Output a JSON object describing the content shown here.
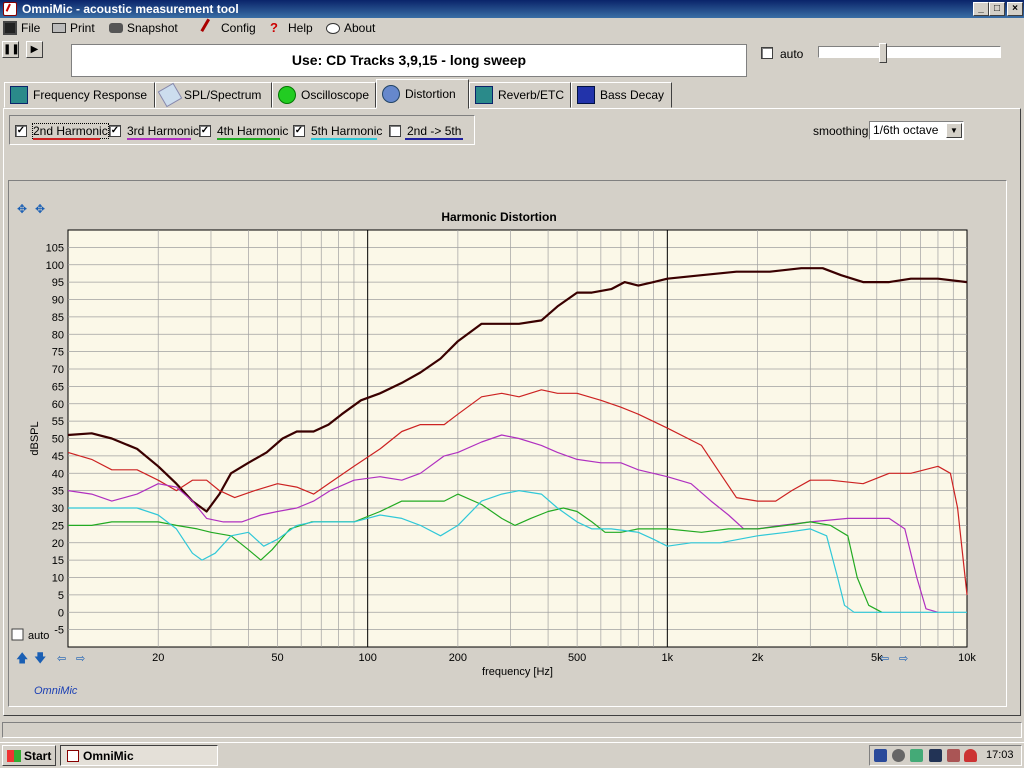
{
  "window": {
    "title": "OmniMic - acoustic measurement tool"
  },
  "menu": {
    "file": "File",
    "print": "Print",
    "snapshot": "Snapshot",
    "config": "Config",
    "help": "Help",
    "about": "About"
  },
  "toolbar": {
    "status_text": "Use: CD Tracks 3,9,15 - long sweep",
    "auto_label": "auto",
    "pause_icon": "pause-icon",
    "play_icon": "play-icon"
  },
  "tabs": [
    {
      "label": "Frequency Response",
      "icon": "frequency-response-icon"
    },
    {
      "label": "SPL/Spectrum",
      "icon": "spl-spectrum-icon"
    },
    {
      "label": "Oscilloscope",
      "icon": "oscilloscope-icon"
    },
    {
      "label": "Distortion",
      "icon": "distortion-icon",
      "active": true
    },
    {
      "label": "Reverb/ETC",
      "icon": "reverb-icon"
    },
    {
      "label": "Bass Decay",
      "icon": "bass-decay-icon"
    }
  ],
  "harmonics": [
    {
      "label": "2nd Harmonic",
      "checked": true,
      "color": "#cc2222"
    },
    {
      "label": "3rd Harmonic",
      "checked": true,
      "color": "#b030c0"
    },
    {
      "label": "4th Harmonic",
      "checked": true,
      "color": "#22aa22"
    },
    {
      "label": "5th Harmonic",
      "checked": true,
      "color": "#30c8d8"
    },
    {
      "label": "2nd -> 5th",
      "checked": false,
      "color": "#2020a0"
    }
  ],
  "smoothing": {
    "label": "smoothing",
    "value": "1/6th octave"
  },
  "chart_footer": {
    "auto_label": "auto",
    "brand": "OmniMic"
  },
  "chart_data": {
    "type": "line",
    "title": "Harmonic Distortion",
    "xlabel": "frequency [Hz]",
    "ylabel": "dBSPL",
    "xscale": "log",
    "xlim": [
      10,
      10000
    ],
    "ylim": [
      -10,
      110
    ],
    "yticks": [
      -5,
      0,
      5,
      10,
      15,
      20,
      25,
      30,
      35,
      40,
      45,
      50,
      55,
      60,
      65,
      70,
      75,
      80,
      85,
      90,
      95,
      100,
      105
    ],
    "xtick_labels": [
      {
        "value": 20,
        "label": "20"
      },
      {
        "value": 50,
        "label": "50"
      },
      {
        "value": 100,
        "label": "100"
      },
      {
        "value": 200,
        "label": "200"
      },
      {
        "value": 500,
        "label": "500"
      },
      {
        "value": 1000,
        "label": "1k"
      },
      {
        "value": 2000,
        "label": "2k"
      },
      {
        "value": 5000,
        "label": "5k"
      },
      {
        "value": 10000,
        "label": "10k"
      }
    ],
    "grid": true,
    "series": [
      {
        "color": "#3a0000",
        "width": 2.2,
        "points": [
          [
            10,
            51
          ],
          [
            12,
            51.5
          ],
          [
            14,
            50
          ],
          [
            17,
            47
          ],
          [
            20,
            42
          ],
          [
            23,
            37
          ],
          [
            26,
            32
          ],
          [
            29,
            29
          ],
          [
            32,
            34
          ],
          [
            35,
            40
          ],
          [
            40,
            43
          ],
          [
            46,
            46
          ],
          [
            52,
            50
          ],
          [
            58,
            52
          ],
          [
            66,
            52
          ],
          [
            74,
            54
          ],
          [
            82,
            57
          ],
          [
            95,
            61
          ],
          [
            110,
            63
          ],
          [
            130,
            66
          ],
          [
            150,
            69
          ],
          [
            175,
            73
          ],
          [
            200,
            78
          ],
          [
            240,
            83
          ],
          [
            280,
            83
          ],
          [
            320,
            83
          ],
          [
            380,
            84
          ],
          [
            430,
            88
          ],
          [
            500,
            92
          ],
          [
            560,
            92
          ],
          [
            650,
            93
          ],
          [
            720,
            95
          ],
          [
            800,
            94
          ],
          [
            900,
            95
          ],
          [
            1000,
            96
          ],
          [
            1300,
            97
          ],
          [
            1700,
            98
          ],
          [
            2200,
            98
          ],
          [
            2800,
            99
          ],
          [
            3300,
            99
          ],
          [
            3800,
            97
          ],
          [
            4500,
            95
          ],
          [
            5500,
            95
          ],
          [
            6500,
            96
          ],
          [
            8000,
            96
          ],
          [
            10000,
            95
          ]
        ]
      },
      {
        "color": "#cc2222",
        "width": 1.2,
        "points": [
          [
            10,
            46
          ],
          [
            12,
            44
          ],
          [
            14,
            41
          ],
          [
            17,
            41
          ],
          [
            20,
            38
          ],
          [
            23,
            35
          ],
          [
            26,
            38
          ],
          [
            29,
            38
          ],
          [
            32,
            35
          ],
          [
            36,
            33
          ],
          [
            42,
            35
          ],
          [
            50,
            37
          ],
          [
            58,
            36
          ],
          [
            66,
            34
          ],
          [
            74,
            37
          ],
          [
            90,
            42
          ],
          [
            110,
            47
          ],
          [
            130,
            52
          ],
          [
            150,
            54
          ],
          [
            180,
            54
          ],
          [
            200,
            57
          ],
          [
            240,
            62
          ],
          [
            280,
            63
          ],
          [
            320,
            62
          ],
          [
            380,
            64
          ],
          [
            430,
            63
          ],
          [
            500,
            63
          ],
          [
            600,
            61
          ],
          [
            700,
            59
          ],
          [
            800,
            57
          ],
          [
            1000,
            53
          ],
          [
            1300,
            48
          ],
          [
            1500,
            40
          ],
          [
            1700,
            33
          ],
          [
            2000,
            32
          ],
          [
            2300,
            32
          ],
          [
            2600,
            35
          ],
          [
            3000,
            38
          ],
          [
            3500,
            38
          ],
          [
            4500,
            37
          ],
          [
            5500,
            40
          ],
          [
            6500,
            40
          ],
          [
            8000,
            42
          ],
          [
            8800,
            40
          ],
          [
            9300,
            30
          ],
          [
            10000,
            5
          ]
        ]
      },
      {
        "color": "#b030c0",
        "width": 1.2,
        "points": [
          [
            10,
            35
          ],
          [
            12,
            34
          ],
          [
            14,
            32
          ],
          [
            17,
            34
          ],
          [
            20,
            37
          ],
          [
            23,
            36
          ],
          [
            26,
            32
          ],
          [
            29,
            27
          ],
          [
            33,
            26
          ],
          [
            38,
            26
          ],
          [
            44,
            28
          ],
          [
            50,
            29
          ],
          [
            58,
            30
          ],
          [
            66,
            32
          ],
          [
            75,
            35
          ],
          [
            90,
            38
          ],
          [
            110,
            39
          ],
          [
            130,
            38
          ],
          [
            150,
            40
          ],
          [
            180,
            45
          ],
          [
            200,
            46
          ],
          [
            240,
            49
          ],
          [
            280,
            51
          ],
          [
            320,
            50
          ],
          [
            380,
            48
          ],
          [
            430,
            46
          ],
          [
            500,
            44
          ],
          [
            600,
            43
          ],
          [
            700,
            43
          ],
          [
            800,
            41
          ],
          [
            1000,
            39
          ],
          [
            1200,
            37
          ],
          [
            1400,
            32
          ],
          [
            1600,
            28
          ],
          [
            1800,
            24
          ],
          [
            2000,
            24
          ],
          [
            2400,
            25
          ],
          [
            3000,
            26
          ],
          [
            4000,
            27
          ],
          [
            5500,
            27
          ],
          [
            6200,
            24
          ],
          [
            6800,
            10
          ],
          [
            7300,
            1
          ],
          [
            8000,
            0
          ]
        ]
      },
      {
        "color": "#22aa22",
        "width": 1.2,
        "points": [
          [
            10,
            25
          ],
          [
            12,
            25
          ],
          [
            14,
            26
          ],
          [
            17,
            26
          ],
          [
            20,
            26
          ],
          [
            23,
            25
          ],
          [
            27,
            24
          ],
          [
            30,
            23
          ],
          [
            35,
            22
          ],
          [
            40,
            18
          ],
          [
            44,
            15
          ],
          [
            48,
            18
          ],
          [
            55,
            24
          ],
          [
            65,
            26
          ],
          [
            75,
            26
          ],
          [
            90,
            26
          ],
          [
            110,
            29
          ],
          [
            130,
            32
          ],
          [
            150,
            32
          ],
          [
            180,
            32
          ],
          [
            200,
            34
          ],
          [
            240,
            31
          ],
          [
            280,
            27
          ],
          [
            310,
            25
          ],
          [
            350,
            27
          ],
          [
            400,
            29
          ],
          [
            450,
            30
          ],
          [
            500,
            29
          ],
          [
            560,
            26
          ],
          [
            620,
            23
          ],
          [
            700,
            23
          ],
          [
            800,
            24
          ],
          [
            1000,
            24
          ],
          [
            1300,
            23
          ],
          [
            1600,
            24
          ],
          [
            2000,
            24
          ],
          [
            2500,
            25
          ],
          [
            3000,
            26
          ],
          [
            3500,
            25
          ],
          [
            4000,
            22
          ],
          [
            4300,
            10
          ],
          [
            4700,
            2
          ],
          [
            5200,
            0
          ]
        ]
      },
      {
        "color": "#30c8d8",
        "width": 1.2,
        "points": [
          [
            10,
            30
          ],
          [
            12,
            30
          ],
          [
            14,
            30
          ],
          [
            17,
            30
          ],
          [
            20,
            28
          ],
          [
            23,
            24
          ],
          [
            26,
            17
          ],
          [
            28,
            15
          ],
          [
            31,
            17
          ],
          [
            35,
            22
          ],
          [
            40,
            23
          ],
          [
            45,
            19
          ],
          [
            50,
            21
          ],
          [
            58,
            25
          ],
          [
            66,
            26
          ],
          [
            75,
            26
          ],
          [
            90,
            26
          ],
          [
            110,
            28
          ],
          [
            130,
            27
          ],
          [
            150,
            25
          ],
          [
            175,
            22
          ],
          [
            200,
            25
          ],
          [
            240,
            32
          ],
          [
            280,
            34
          ],
          [
            320,
            35
          ],
          [
            380,
            34
          ],
          [
            430,
            30
          ],
          [
            500,
            26
          ],
          [
            560,
            24
          ],
          [
            650,
            24
          ],
          [
            800,
            23
          ],
          [
            900,
            21
          ],
          [
            1000,
            19
          ],
          [
            1200,
            20
          ],
          [
            1500,
            20
          ],
          [
            2000,
            22
          ],
          [
            2500,
            23
          ],
          [
            3000,
            24
          ],
          [
            3400,
            22
          ],
          [
            3700,
            10
          ],
          [
            3900,
            2
          ],
          [
            4200,
            0
          ],
          [
            10000,
            0
          ]
        ]
      }
    ]
  }
}
